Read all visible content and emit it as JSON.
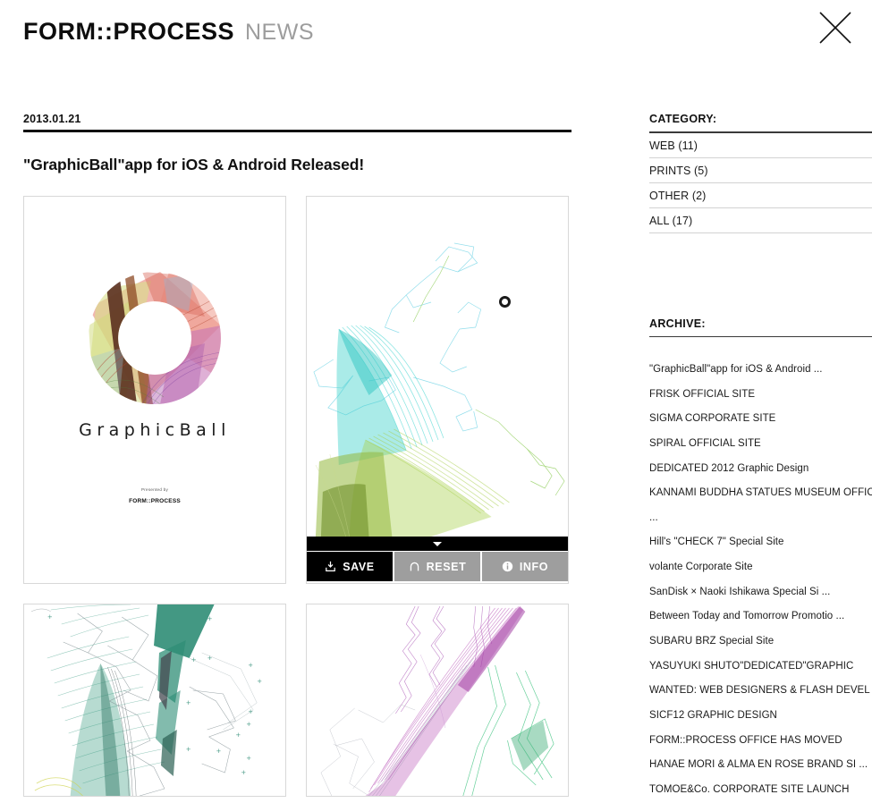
{
  "header": {
    "brand_main": "FORM::PROCESS",
    "brand_sub": "NEWS",
    "close_label": "×"
  },
  "post": {
    "date": "2013.01.21",
    "title": "\"GraphicBall\"app for iOS & Android Released!"
  },
  "artwork": {
    "cover_word": "GraphicBall",
    "cover_presented": "Presented by",
    "cover_byline": "FORM::PROCESS"
  },
  "viewer": {
    "collapse_icon": "chevron-down-icon",
    "buttons": [
      {
        "label": "SAVE",
        "icon": "download-icon",
        "style": "dark"
      },
      {
        "label": "RESET",
        "icon": "undo-icon",
        "style": "grey"
      },
      {
        "label": "INFO",
        "icon": "info-icon",
        "style": "grey"
      }
    ]
  },
  "sidebar": {
    "category_heading": "CATEGORY:",
    "categories": [
      "WEB (11)",
      "PRINTS (5)",
      "OTHER (2)",
      "ALL (17)"
    ],
    "archive_heading": "ARCHIVE:",
    "archive": [
      "\"GraphicBall\"app for iOS & Android ...",
      "FRISK OFFICIAL SITE",
      "SIGMA CORPORATE SITE",
      "SPIRAL OFFICIAL SITE",
      "DEDICATED 2012 Graphic Design",
      "KANNAMI BUDDHA STATUES MUSEUM OFFIC",
      "...",
      "Hill's \"CHECK 7\" Special Site",
      "volante Corporate Site",
      "SanDisk × Naoki Ishikawa Special Si ...",
      "Between Today and Tomorrow Promotio ...",
      "SUBARU BRZ Special Site",
      "YASUYUKI SHUTO\"DEDICATED\"GRAPHIC",
      "WANTED: WEB DESIGNERS & FLASH DEVEL ...",
      "SICF12 GRAPHIC DESIGN",
      "FORM::PROCESS OFFICE HAS MOVED",
      "HANAE MORI & ALMA EN ROSE BRAND SI ...",
      "TOMOE&Co. CORPORATE SITE LAUNCH"
    ]
  },
  "colors": {
    "text": "#111111",
    "muted": "#9d9d9d",
    "rule": "#111111",
    "button_dark": "#000000",
    "button_grey": "#9e9e9e",
    "tile_border": "#d8d8d8"
  }
}
